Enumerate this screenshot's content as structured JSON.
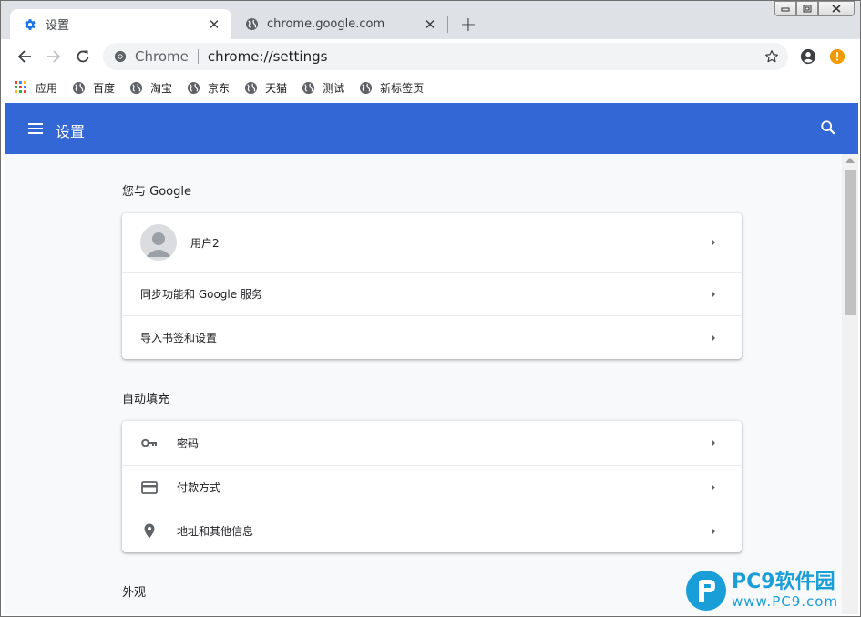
{
  "colors": {
    "header_blue": "#3367d6",
    "tab_strip": "#dee1e6",
    "content_bg": "#f8f9fa",
    "warning_orange": "#f29900",
    "settings_icon_blue": "#1a73e8",
    "watermark_blue": "#1a9ed8"
  },
  "tabs": [
    {
      "title": "设置",
      "icon": "gear-icon",
      "active": true
    },
    {
      "title": "chrome.google.com",
      "icon": "globe-icon",
      "active": false
    }
  ],
  "toolbar": {
    "chip": "Chrome",
    "url": "chrome://settings"
  },
  "bookmarks": [
    {
      "label": "应用",
      "icon": "apps-grid-icon"
    },
    {
      "label": "百度",
      "icon": "globe-icon"
    },
    {
      "label": "淘宝",
      "icon": "globe-icon"
    },
    {
      "label": "京东",
      "icon": "globe-icon"
    },
    {
      "label": "天猫",
      "icon": "globe-icon"
    },
    {
      "label": "测试",
      "icon": "globe-icon"
    },
    {
      "label": "新标签页",
      "icon": "globe-icon"
    }
  ],
  "header": {
    "title": "设置"
  },
  "sections": {
    "you_and_google": {
      "title": "您与 Google",
      "items": [
        {
          "label": "用户2",
          "icon": "avatar"
        },
        {
          "label": "同步功能和 Google 服务"
        },
        {
          "label": "导入书签和设置"
        }
      ]
    },
    "autofill": {
      "title": "自动填充",
      "items": [
        {
          "label": "密码",
          "icon": "key-icon"
        },
        {
          "label": "付款方式",
          "icon": "credit-card-icon"
        },
        {
          "label": "地址和其他信息",
          "icon": "location-pin-icon"
        }
      ]
    },
    "appearance": {
      "title": "外观"
    }
  },
  "watermark": {
    "brand": "PC9软件园",
    "url": "www.PC9.com"
  }
}
